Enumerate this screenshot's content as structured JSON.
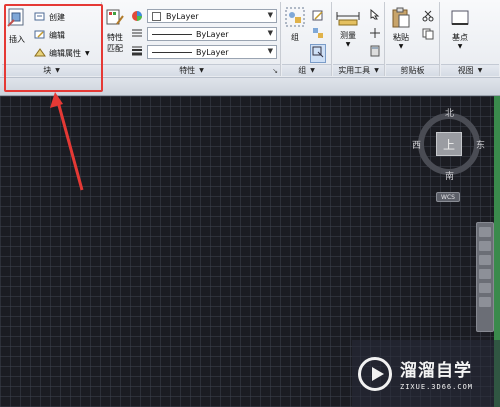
{
  "ribbon": {
    "block": {
      "insert_label": "插入",
      "create_label": "创建",
      "edit_label": "编辑",
      "edit_attr_label": "编辑属性",
      "panel_label": "块"
    },
    "properties": {
      "match_label_1": "特性",
      "match_label_2": "匹配",
      "color_value": "ByLayer",
      "linetype_value": "ByLayer",
      "lineweight_value": "ByLayer",
      "panel_label": "特性"
    },
    "group": {
      "group_label": "组",
      "panel_label": "组"
    },
    "utilities": {
      "measure_label": "测量",
      "panel_label": "实用工具"
    },
    "clipboard": {
      "paste_label": "粘贴",
      "panel_label": "剪贴板"
    },
    "view": {
      "basepoint_label": "基点",
      "panel_label": "视图"
    }
  },
  "viewcube": {
    "top_face": "上",
    "north": "北",
    "south": "南",
    "east": "东",
    "west": "西",
    "wcs_label": "WCS"
  },
  "watermark": {
    "main": "溜溜自学",
    "sub": "ZIXUE.3D66.COM"
  },
  "colors": {
    "highlight": "#e53935",
    "canvas_bg": "#1b1c22"
  }
}
